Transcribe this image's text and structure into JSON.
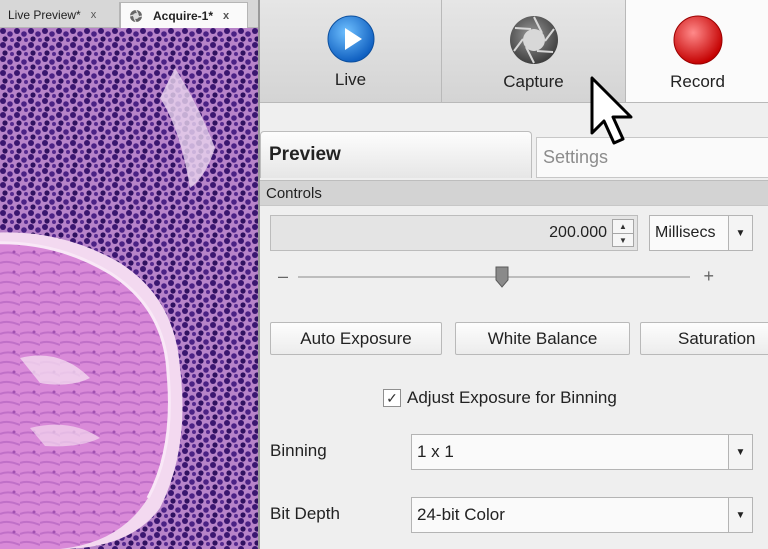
{
  "doc_tabs": [
    {
      "label": "Live Preview*",
      "close": "x"
    },
    {
      "label": "Acquire-1*",
      "close": "x",
      "icon": "aperture-icon"
    }
  ],
  "toolbar": {
    "live_label": "Live",
    "capture_label": "Capture",
    "record_label": "Record",
    "colors": {
      "live": "#1e7fd8",
      "record": "#e01818",
      "capture": "#6e6e6e"
    }
  },
  "panel_tabs": {
    "preview": "Preview",
    "settings": "Settings",
    "active": "Preview"
  },
  "controls": {
    "section_title": "Controls",
    "exposure_value": "200.000",
    "exposure_unit": "Millisecs",
    "slider": {
      "minus": "–",
      "plus": "+",
      "position": 0.52
    },
    "auto_exposure": "Auto Exposure",
    "white_balance": "White Balance",
    "saturation": "Saturation",
    "adjust_binning": {
      "label": "Adjust Exposure for Binning",
      "checked": true
    },
    "binning": {
      "label": "Binning",
      "value": "1 x 1"
    },
    "bit_depth": {
      "label": "Bit Depth",
      "value": "24-bit Color"
    }
  }
}
